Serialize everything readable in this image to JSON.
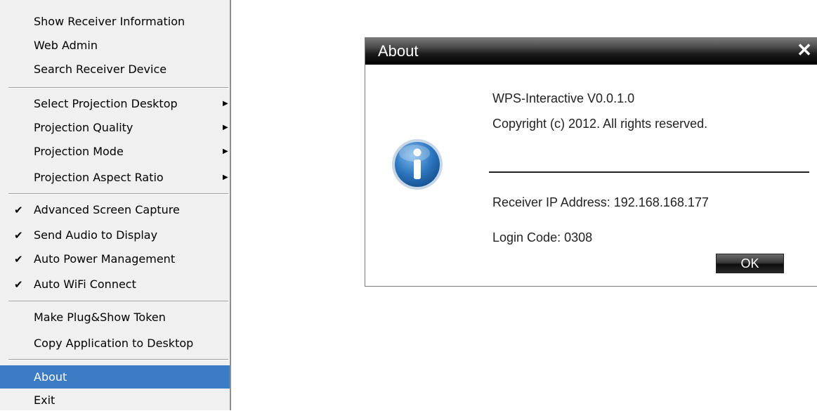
{
  "menu": {
    "items": [
      {
        "label": "Show Receiver Information"
      },
      {
        "label": "Web Admin"
      },
      {
        "label": "Search Receiver Device"
      },
      {
        "label": "Select Projection Desktop",
        "submenu": true
      },
      {
        "label": "Projection Quality",
        "submenu": true
      },
      {
        "label": "Projection Mode",
        "submenu": true
      },
      {
        "label": "Projection Aspect Ratio",
        "submenu": true
      },
      {
        "label": "Advanced Screen Capture",
        "checked": true
      },
      {
        "label": "Send Audio to Display",
        "checked": true
      },
      {
        "label": "Auto Power Management",
        "checked": true
      },
      {
        "label": "Auto WiFi Connect",
        "checked": true
      },
      {
        "label": "Make Plug&Show Token"
      },
      {
        "label": "Copy Application to Desktop"
      },
      {
        "label": "About",
        "highlighted": true
      },
      {
        "label": "Exit"
      }
    ],
    "check_glyph": "✔",
    "arrow_glyph": "▶",
    "highlight_color": "#3c7cc4"
  },
  "dialog": {
    "title": "About",
    "close_glyph": "✕",
    "app_version": "WPS-Interactive V0.0.1.0",
    "copyright": "Copyright (c) 2012. All rights reserved.",
    "receiver_ip": "Receiver IP Address: 192.168.168.177",
    "login_code": "Login Code: 0308",
    "ok_label": "OK",
    "icon": "info-icon"
  }
}
